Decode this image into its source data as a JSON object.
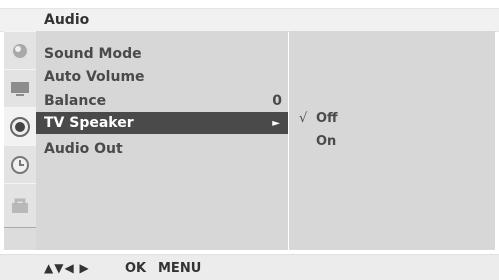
{
  "title": "Audio",
  "menu": {
    "items": [
      {
        "label": "Sound Mode",
        "value": ""
      },
      {
        "label": "Auto Volume",
        "value": ""
      },
      {
        "label": "Balance",
        "value": "0"
      },
      {
        "label": "TV Speaker",
        "value": "",
        "selected": true
      },
      {
        "label": "Audio Out",
        "value": ""
      }
    ],
    "selected_arrow": "►"
  },
  "submenu": {
    "options": [
      "Off",
      "On"
    ],
    "selected": "Off",
    "check_mark": "√"
  },
  "icons": [
    "picture-icon",
    "tv-icon",
    "speaker-icon",
    "clock-icon",
    "lock-icon"
  ],
  "footer": {
    "nav": "▲▼◀ ▶",
    "ok": "OK",
    "menu": "MENU"
  },
  "colors": {
    "panel": "#d7d7d7",
    "selected_bg": "#4a4a4a",
    "selected_text": "#ffffff",
    "text": "#4a4a4a"
  }
}
